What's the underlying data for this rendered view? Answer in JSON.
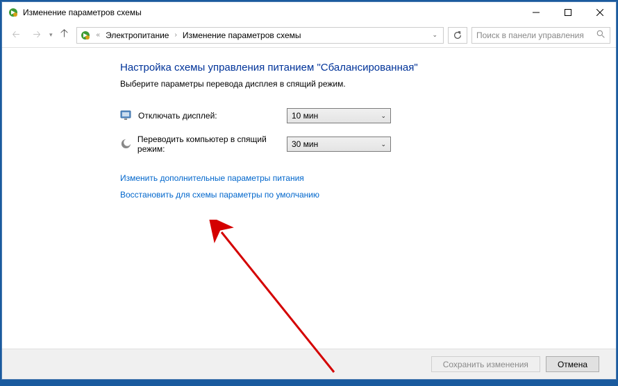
{
  "titlebar": {
    "title": "Изменение параметров схемы"
  },
  "breadcrumb": {
    "root": "Электропитание",
    "current": "Изменение параметров схемы"
  },
  "search": {
    "placeholder": "Поиск в панели управления"
  },
  "page": {
    "heading": "Настройка схемы управления питанием \"Сбалансированная\"",
    "sub": "Выберите параметры перевода дисплея в спящий режим."
  },
  "settings": {
    "display_off": {
      "label": "Отключать дисплей:",
      "value": "10 мин"
    },
    "sleep": {
      "label": "Переводить компьютер в спящий режим:",
      "value": "30 мин"
    }
  },
  "links": {
    "advanced": "Изменить дополнительные параметры питания",
    "restore": "Восстановить для схемы параметры по умолчанию"
  },
  "footer": {
    "save": "Сохранить изменения",
    "cancel": "Отмена"
  }
}
